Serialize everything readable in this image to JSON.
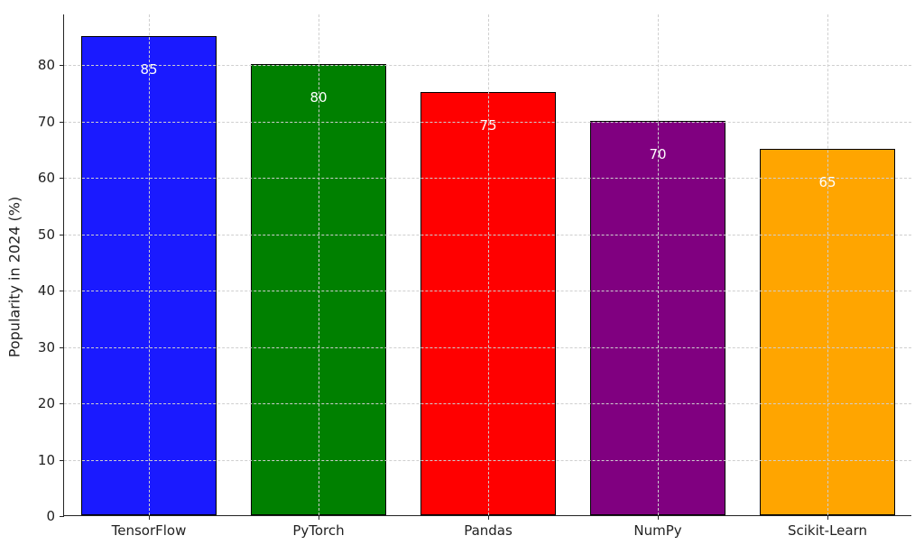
{
  "chart_data": {
    "type": "bar",
    "categories": [
      "TensorFlow",
      "PyTorch",
      "Pandas",
      "NumPy",
      "Scikit-Learn"
    ],
    "values": [
      85,
      80,
      75,
      70,
      65
    ],
    "colors": [
      "#1a1aff",
      "#008000",
      "#ff0000",
      "#800080",
      "#ffa500"
    ],
    "ylabel": "Popularity in 2024 (%)",
    "ylim": [
      0,
      89
    ],
    "yticks": [
      0,
      10,
      20,
      30,
      40,
      50,
      60,
      70,
      80
    ],
    "bar_labels": [
      "85",
      "80",
      "75",
      "70",
      "65"
    ]
  }
}
